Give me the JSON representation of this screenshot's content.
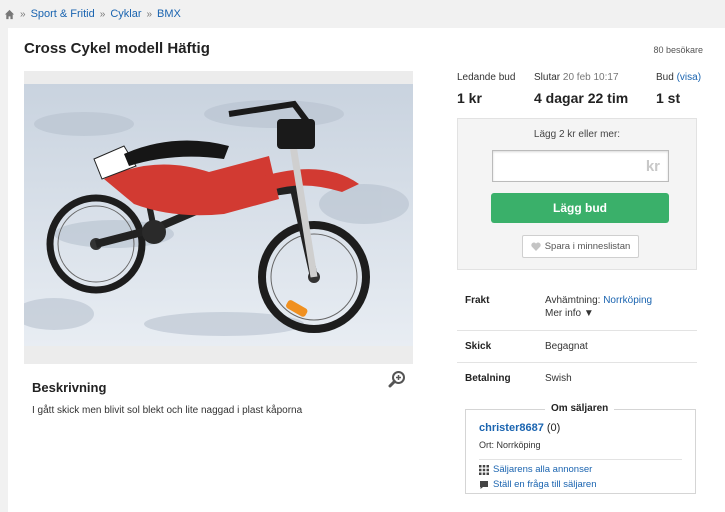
{
  "breadcrumb": [
    "Sport & Fritid",
    "Cyklar",
    "BMX"
  ],
  "title": "Cross Cykel modell Häftig",
  "visitors": "80 besökare",
  "stats": {
    "leading_bid_label": "Ledande bud",
    "leading_bid_value": "1 kr",
    "ends_label": "Slutar",
    "ends_date": "20 feb 10:17",
    "ends_value": "4 dagar 22 tim",
    "bids_label": "Bud",
    "bids_link": "(visa)",
    "bids_value": "1 st"
  },
  "bid": {
    "hint": "Lägg 2 kr eller mer:",
    "input_value": "",
    "currency": "kr",
    "button": "Lägg bud",
    "save": "Spara i minneslistan"
  },
  "info": {
    "frakt_label": "Frakt",
    "frakt_value": "Avhämtning:",
    "frakt_place": "Norrköping",
    "more": "Mer info",
    "skick_label": "Skick",
    "skick_value": "Begagnat",
    "betalning_label": "Betalning",
    "betalning_value": "Swish"
  },
  "description": {
    "heading": "Beskrivning",
    "text": "I gått skick men blivit sol blekt och lite naggad i plast kåporna"
  },
  "seller": {
    "legend": "Om säljaren",
    "name": "christer8687",
    "rating": "(0)",
    "location": "Ort: Norrköping",
    "all_ads": "Säljarens alla annonser",
    "ask": "Ställ en fråga till säljaren"
  },
  "colors": {
    "link": "#1a64b0",
    "bid_button": "#3ab06a"
  }
}
